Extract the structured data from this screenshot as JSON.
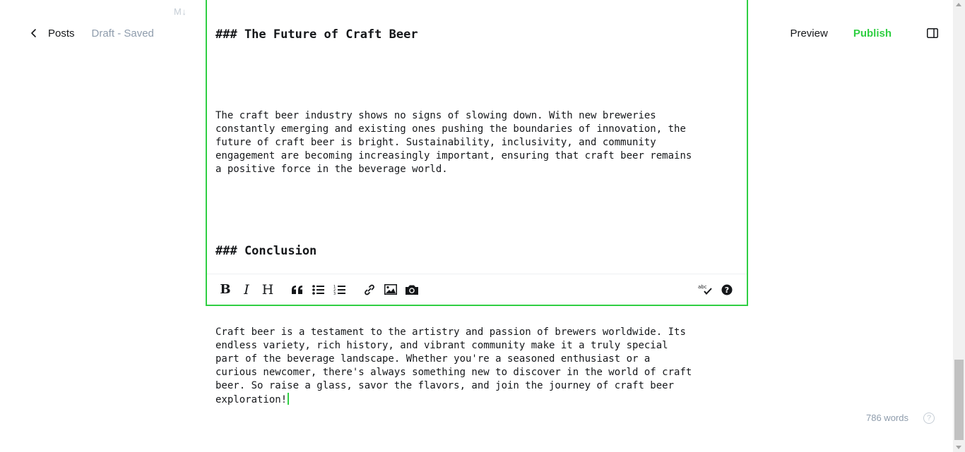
{
  "header": {
    "back_label": "Posts",
    "status": "Draft - Saved",
    "markdown_badge": "M↓",
    "preview_label": "Preview",
    "publish_label": "Publish"
  },
  "editor": {
    "heading1": "### The Future of Craft Beer",
    "paragraph1": "The craft beer industry shows no signs of slowing down. With new breweries\nconstantly emerging and existing ones pushing the boundaries of innovation, the\nfuture of craft beer is bright. Sustainability, inclusivity, and community\nengagement are becoming increasingly important, ensuring that craft beer remains\na positive force in the beverage world.",
    "heading2": "### Conclusion",
    "paragraph2": "Craft beer is a testament to the artistry and passion of brewers worldwide. Its\nendless variety, rich history, and vibrant community make it a truly special\npart of the beverage landscape. Whether you're a seasoned enthusiast or a\ncurious newcomer, there's always something new to discover in the world of craft\nbeer. So raise a glass, savor the flavors, and join the journey of craft beer\nexploration!"
  },
  "toolbar": {
    "bold_label": "B",
    "italic_label": "I",
    "heading_label": "H",
    "icons": [
      "quote-icon",
      "unordered-list-icon",
      "ordered-list-icon",
      "link-icon",
      "image-icon",
      "camera-icon",
      "spellcheck-icon",
      "help-icon"
    ],
    "spellcheck_text": "abc"
  },
  "footer": {
    "word_count": "786 words",
    "help_glyph": "?"
  },
  "colors": {
    "accent": "#30cf43",
    "muted": "#8e9cac",
    "text": "#15171a"
  }
}
